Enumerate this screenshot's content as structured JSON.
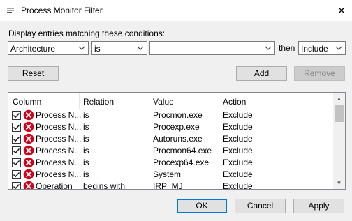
{
  "window": {
    "title": "Process Monitor Filter",
    "close_glyph": "✕"
  },
  "conditions": {
    "label": "Display entries matching these conditions:",
    "column": "Architecture",
    "relation": "is",
    "value": "",
    "then_label": "then",
    "action": "Include"
  },
  "buttons": {
    "reset": "Reset",
    "add": "Add",
    "remove": "Remove",
    "ok": "OK",
    "cancel": "Cancel",
    "apply": "Apply"
  },
  "table": {
    "headers": [
      "Column",
      "Relation",
      "Value",
      "Action"
    ],
    "rows": [
      {
        "column": "Process N...",
        "relation": "is",
        "value": "Procmon.exe",
        "action": "Exclude",
        "checked": true,
        "icon": "exclude-icon"
      },
      {
        "column": "Process N...",
        "relation": "is",
        "value": "Procexp.exe",
        "action": "Exclude",
        "checked": true,
        "icon": "exclude-icon"
      },
      {
        "column": "Process N...",
        "relation": "is",
        "value": "Autoruns.exe",
        "action": "Exclude",
        "checked": true,
        "icon": "exclude-icon"
      },
      {
        "column": "Process N...",
        "relation": "is",
        "value": "Procmon64.exe",
        "action": "Exclude",
        "checked": true,
        "icon": "exclude-icon"
      },
      {
        "column": "Process N...",
        "relation": "is",
        "value": "Procexp64.exe",
        "action": "Exclude",
        "checked": true,
        "icon": "exclude-icon"
      },
      {
        "column": "Process N...",
        "relation": "is",
        "value": "System",
        "action": "Exclude",
        "checked": true,
        "icon": "exclude-icon"
      },
      {
        "column": "Operation",
        "relation": "begins with",
        "value": "IRP_MJ_",
        "action": "Exclude",
        "checked": true,
        "icon": "exclude-icon"
      }
    ]
  },
  "colors": {
    "accent": "#0078d7",
    "exclude": "#d0021b"
  }
}
